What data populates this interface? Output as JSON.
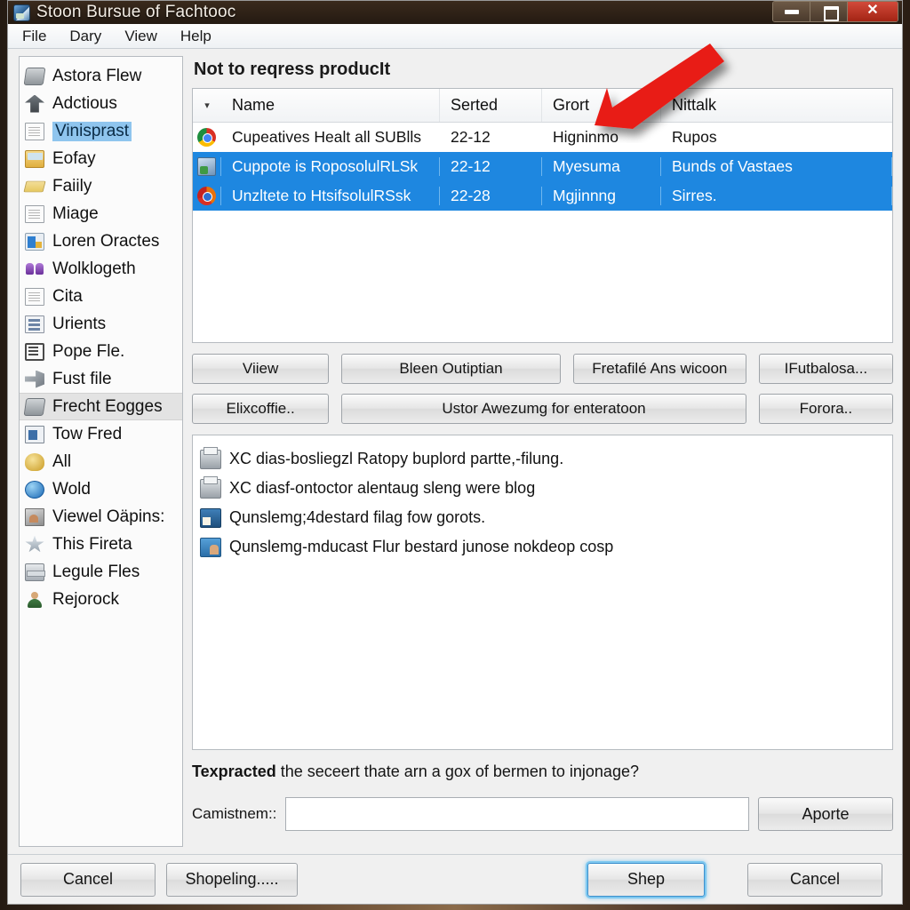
{
  "window": {
    "title": "Stoon Bursue of Fachtooc",
    "icon": "picture-icon",
    "controls": {
      "minimize": "minimize-icon",
      "maximize": "maximize-icon",
      "close": "close-icon"
    }
  },
  "menubar": {
    "items": [
      "File",
      "Dary",
      "View",
      "Help"
    ]
  },
  "sidebar": {
    "items": [
      {
        "label": "Astora Flew",
        "icon": "scanner-icon",
        "state": "normal"
      },
      {
        "label": "Adctious",
        "icon": "arrow-up-icon",
        "state": "normal"
      },
      {
        "label": "Vinisprast",
        "icon": "document-icon",
        "state": "selected"
      },
      {
        "label": "Eofay",
        "icon": "mail-icon",
        "state": "normal"
      },
      {
        "label": "Faiily",
        "icon": "folder-icon",
        "state": "normal"
      },
      {
        "label": "Miage",
        "icon": "document-icon",
        "state": "normal"
      },
      {
        "label": "Loren Oractes",
        "icon": "chart-icon",
        "state": "normal"
      },
      {
        "label": "Wolklogeth",
        "icon": "people-icon",
        "state": "normal"
      },
      {
        "label": "Cita",
        "icon": "document-icon",
        "state": "normal"
      },
      {
        "label": "Urients",
        "icon": "doc-lines-icon",
        "state": "normal"
      },
      {
        "label": "Pope Fle.",
        "icon": "notes-icon",
        "state": "normal"
      },
      {
        "label": "Fust file",
        "icon": "wrench-icon",
        "state": "normal"
      },
      {
        "label": "Frecht Eogges",
        "icon": "scanner-icon",
        "state": "hover"
      },
      {
        "label": "Tow Fred",
        "icon": "presentation-icon",
        "state": "normal"
      },
      {
        "label": "All",
        "icon": "gold-seal-icon",
        "state": "normal"
      },
      {
        "label": "Wold",
        "icon": "globe-icon",
        "state": "normal"
      },
      {
        "label": "Viewel Oäpins:",
        "icon": "photo-icon",
        "state": "normal"
      },
      {
        "label": "This Fireta",
        "icon": "star-icon",
        "state": "normal"
      },
      {
        "label": "Legule Fles",
        "icon": "press-icon",
        "state": "normal"
      },
      {
        "label": "Rejorock",
        "icon": "person-icon",
        "state": "normal"
      }
    ]
  },
  "main": {
    "pane_title": "Not to reqress producIt",
    "table": {
      "columns": [
        "Name",
        "Serted",
        "Grort",
        "Nittalk"
      ],
      "sort_indicator": "▾",
      "rows": [
        {
          "icon": "chrome-icon",
          "name": "Cupeatives Healt all SUBlls",
          "serted": "22-12",
          "grort": "Higninmo",
          "nittalk": "Rupos",
          "selected": false
        },
        {
          "icon": "document-blue-icon",
          "name": "Cuppote is RoposolulRLSk",
          "serted": "22-12",
          "grort": "Myesuma",
          "nittalk": "Bunds of Vastaes",
          "selected": true
        },
        {
          "icon": "chrome-alt-icon",
          "name": "Unzltete to HtsifsolulRSsk",
          "serted": "22-28",
          "grort": "Mgjinnng",
          "nittalk": "Sirres.",
          "selected": true
        }
      ]
    },
    "buttons_row1": [
      "Viiew",
      "Bleen Outiptian",
      "Fretafilé Ans wicoon",
      "IFutbalosa..."
    ],
    "buttons_row2": [
      "Elixcoffie..",
      "Ustor Awezumg for enteratoon",
      "Forora.."
    ],
    "detail_list": [
      {
        "icon": "printer-icon",
        "label": "XC dias-bosliegzl Ratopy buplord partte,-filung."
      },
      {
        "icon": "printer-icon",
        "label": "XC diasf-ontoctor alentaug sleng were blog"
      },
      {
        "icon": "store-icon",
        "label": "Qunslemg;4destard filag fow gorots."
      },
      {
        "icon": "people-icon",
        "label": "Qunslemg-mducast Flur bestard junose nokdeop cosp"
      }
    ],
    "question_bold": "Texpracted",
    "question_rest": " the seceert thate arn a gox of bermen to injonage?",
    "input_label": "Camistnem::",
    "input_value": "",
    "input_placeholder": "",
    "input_button": "Aporte"
  },
  "footer": {
    "cancel_left": "Cancel",
    "shopeling": "Shopeling.....",
    "shep": "Shep",
    "cancel_right": "Cancel"
  },
  "annotation": {
    "arrow": "red-arrow-pointer",
    "color": "#e81b15"
  }
}
